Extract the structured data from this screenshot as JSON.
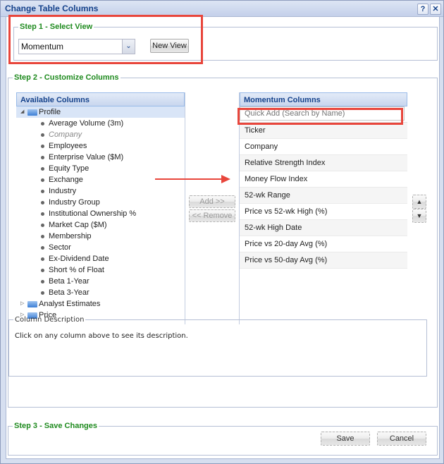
{
  "window": {
    "title": "Change Table Columns",
    "help_label": "?",
    "close_label": "✕"
  },
  "step1": {
    "legend": "Step 1 - Select View",
    "view_select": {
      "value": "Momentum",
      "arrow": "⌄"
    },
    "new_view_label": "New View"
  },
  "step2": {
    "legend": "Step 2 - Customize Columns",
    "available": {
      "header": "Available Columns",
      "tree": [
        {
          "label": "Profile",
          "expanded": true,
          "children": [
            {
              "label": "Average Volume (3m)",
              "disabled": false
            },
            {
              "label": "Company",
              "disabled": true
            },
            {
              "label": "Employees",
              "disabled": false
            },
            {
              "label": "Enterprise Value ($M)",
              "disabled": false
            },
            {
              "label": "Equity Type",
              "disabled": false
            },
            {
              "label": "Exchange",
              "disabled": false
            },
            {
              "label": "Industry",
              "disabled": false
            },
            {
              "label": "Industry Group",
              "disabled": false
            },
            {
              "label": "Institutional Ownership %",
              "disabled": false
            },
            {
              "label": "Market Cap ($M)",
              "disabled": false
            },
            {
              "label": "Membership",
              "disabled": false
            },
            {
              "label": "Sector",
              "disabled": false
            },
            {
              "label": "Ex-Dividend Date",
              "disabled": false
            },
            {
              "label": "Short % of Float",
              "disabled": false
            },
            {
              "label": "Beta 1-Year",
              "disabled": false
            },
            {
              "label": "Beta 3-Year",
              "disabled": false
            }
          ]
        },
        {
          "label": "Analyst Estimates",
          "expanded": false
        },
        {
          "label": "Price",
          "expanded": false
        }
      ]
    },
    "add_label": "Add >>",
    "remove_label": "<< Remove",
    "selected": {
      "header": "Momentum Columns",
      "quick_add_placeholder": "Quick Add (Search by Name)",
      "columns": [
        "Ticker",
        "Company",
        "Relative Strength Index",
        "Money Flow Index",
        "52-wk Range",
        "Price vs 52-wk High (%)",
        "52-wk High Date",
        "Price vs 20-day Avg (%)",
        "Price vs 50-day Avg (%)"
      ]
    },
    "move_up_label": "▲",
    "move_down_label": "▼",
    "description": {
      "legend": "Column Description",
      "text": "Click on any column above to see its description."
    }
  },
  "step3": {
    "legend": "Step 3 - Save Changes",
    "save_label": "Save",
    "cancel_label": "Cancel"
  },
  "colors": {
    "title_text": "#15428b",
    "legend_text": "#1e8a1e",
    "highlight": "#e8463c"
  }
}
